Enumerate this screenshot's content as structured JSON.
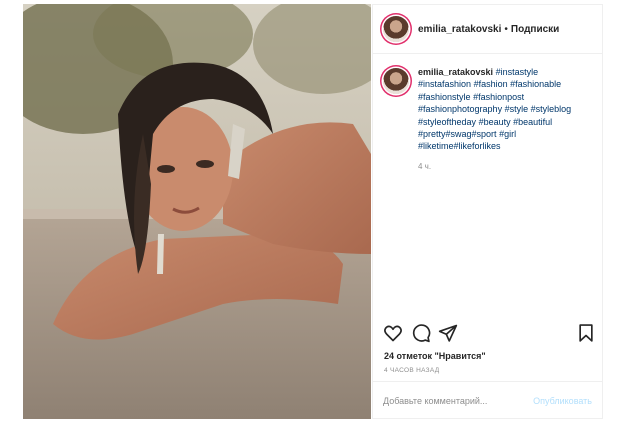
{
  "header": {
    "username": "emilia_ratakovski",
    "separator": "•",
    "follow_label": "Подписки"
  },
  "caption": {
    "username": "emilia_ratakovski",
    "hashtags": [
      "#instastyle",
      "#instafashion",
      "#fashion",
      "#fashionable",
      "#fashionstyle",
      "#fashionpost",
      "#fashionphotography",
      "#style",
      "#styleblog",
      "#styleoftheday",
      "#beauty",
      "#beautiful",
      "#pretty",
      "#swag",
      "#sport",
      "#girl",
      "#liketime",
      "#likeforlikes"
    ],
    "time": "4 ч."
  },
  "actions": {
    "like_icon": "heart-icon",
    "comment_icon": "comment-icon",
    "share_icon": "paper-plane-icon",
    "save_icon": "bookmark-icon"
  },
  "likes": "24 отметок \"Нравится\"",
  "time_ago": "4 ЧАСОВ НАЗАД",
  "comment": {
    "placeholder": "Добавьте комментарий...",
    "post_label": "Опубликовать"
  },
  "colors": {
    "story_ring": "#e1306c",
    "hashtag": "#00376b",
    "muted": "#8e8e8e",
    "post_disabled": "#b2dffc"
  }
}
